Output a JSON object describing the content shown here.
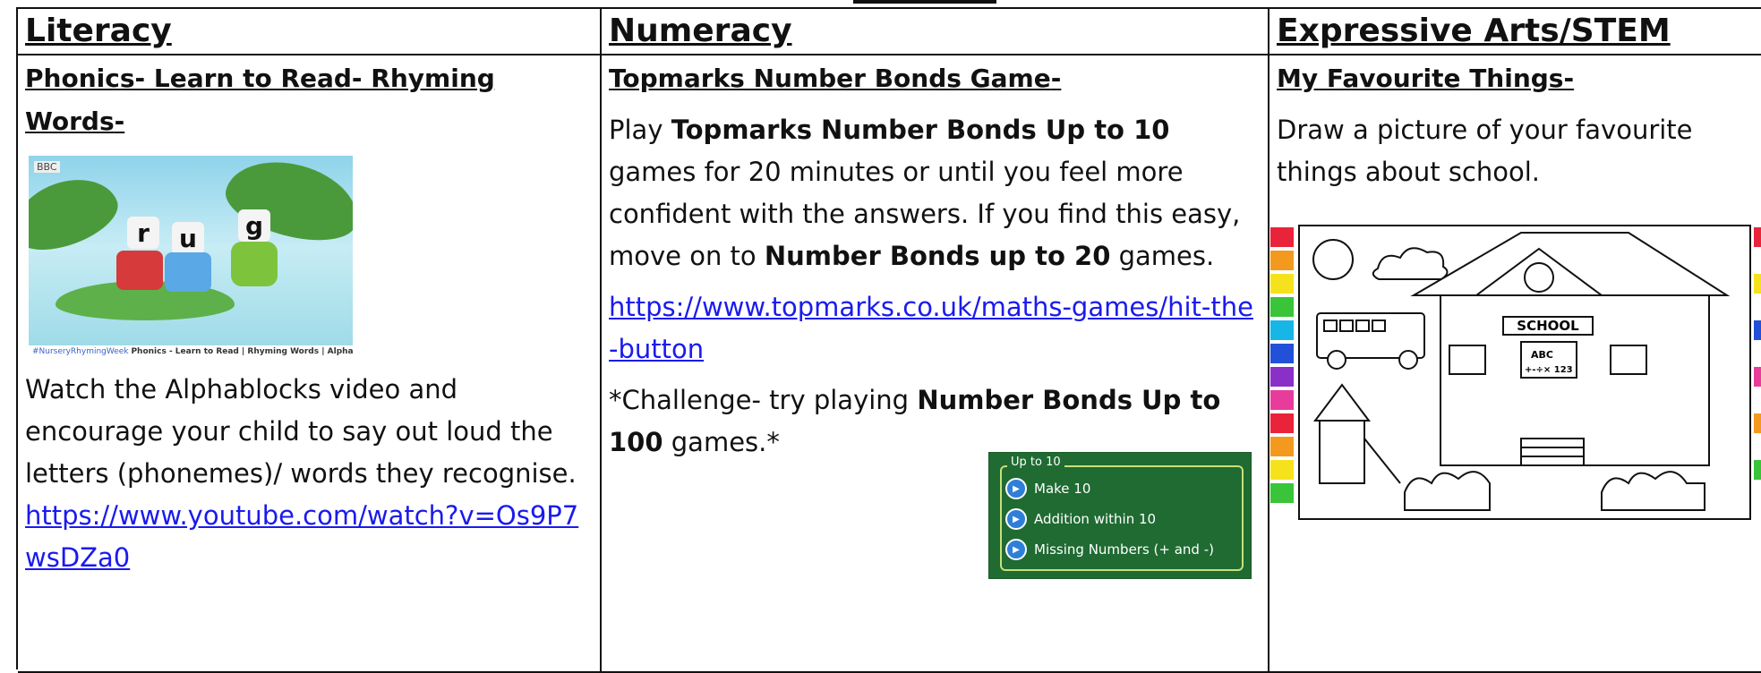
{
  "columns": {
    "literacy": {
      "heading": "Literacy",
      "subheading": "Phonics- Learn to Read- Rhyming Words",
      "subheading_suffix": "-",
      "video": {
        "badge": "BBC",
        "letters": [
          "r",
          "u",
          "g"
        ],
        "caption_hashtag": "#NurseryRhymingWeek",
        "caption_text": "Phonics - Learn to Read | Rhyming Words | Alphablocks"
      },
      "body": "Watch the Alphablocks video and encourage your child to say out loud the letters (phonemes)/ words they recognise.",
      "link": "https://www.youtube.com/watch?v=Os9P7wsDZa0"
    },
    "numeracy": {
      "heading": "Numeracy",
      "subheading": "Topmarks Number Bonds Game",
      "subheading_suffix": "-",
      "p1_a": "Play ",
      "p1_b": "Topmarks Number Bonds Up to 10",
      "p1_c": " games for 20 minutes or until you feel more confident with the answers. If you find this easy, move on to ",
      "p1_d": "Number Bonds up to 20",
      "p1_e": " games.",
      "link": "https://www.topmarks.co.uk/maths-games/hit-the-button",
      "p2_a": "*Challenge- try playing ",
      "p2_b": "Number Bonds Up to 100",
      "p2_c": " games.*",
      "game": {
        "legend": "Up to 10",
        "options": [
          "Make 10",
          "Addition within 10",
          "Missing Numbers (+ and -)"
        ]
      }
    },
    "arts": {
      "heading": "Expressive Arts/STEM",
      "subheading": "My Favourite Things",
      "subheading_suffix": "-",
      "body": "Draw a picture of your favourite things about school.",
      "illustration": {
        "sign": "SCHOOL",
        "board_line1": "ABC",
        "board_line2": "+-÷× 123"
      }
    }
  }
}
